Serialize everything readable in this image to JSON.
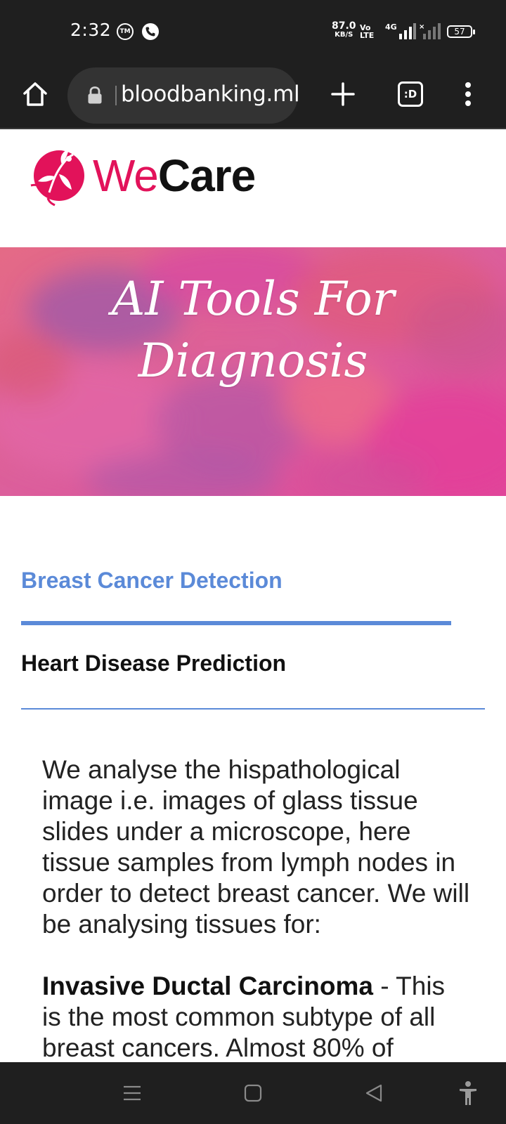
{
  "status_bar": {
    "time": "2:32",
    "tm_badge": "TM",
    "net_speed_value": "87.0",
    "net_speed_unit": "KB/S",
    "volte_top": "Vo",
    "volte_bottom": "LTE",
    "network_type": "4G",
    "battery": "57"
  },
  "browser": {
    "url": "bloodbanking.ml",
    "tabs_label": ":D",
    "icons": [
      "home-icon",
      "lock-icon",
      "plus-icon",
      "tabs-icon",
      "more-vert-icon"
    ]
  },
  "page": {
    "logo": {
      "we": "We",
      "care": "Care"
    },
    "hero": {
      "line1": "AI Tools For",
      "line2": "Diagnosis"
    },
    "tabs": [
      {
        "label": "Breast Cancer Detection",
        "active": true
      },
      {
        "label": "Heart Disease Prediction",
        "active": false
      }
    ],
    "paragraph1": "We analyse the hispathological image i.e. images of glass tissue slides under a microscope, here tissue samples from lymph nodes in order to detect breast cancer. We will be analysing tissues for:",
    "term": "Invasive Ductal Carcinoma",
    "term_description": " - This is the most common subtype of all breast cancers. Almost 80% of"
  },
  "colors": {
    "accent_blue": "#5b8ad8",
    "brand_pink": "#e2125a",
    "dark_bar": "#1f1f1f"
  },
  "nav_bar": {
    "icons": [
      "menu-icon",
      "home-square-icon",
      "back-icon",
      "accessibility-icon"
    ]
  }
}
